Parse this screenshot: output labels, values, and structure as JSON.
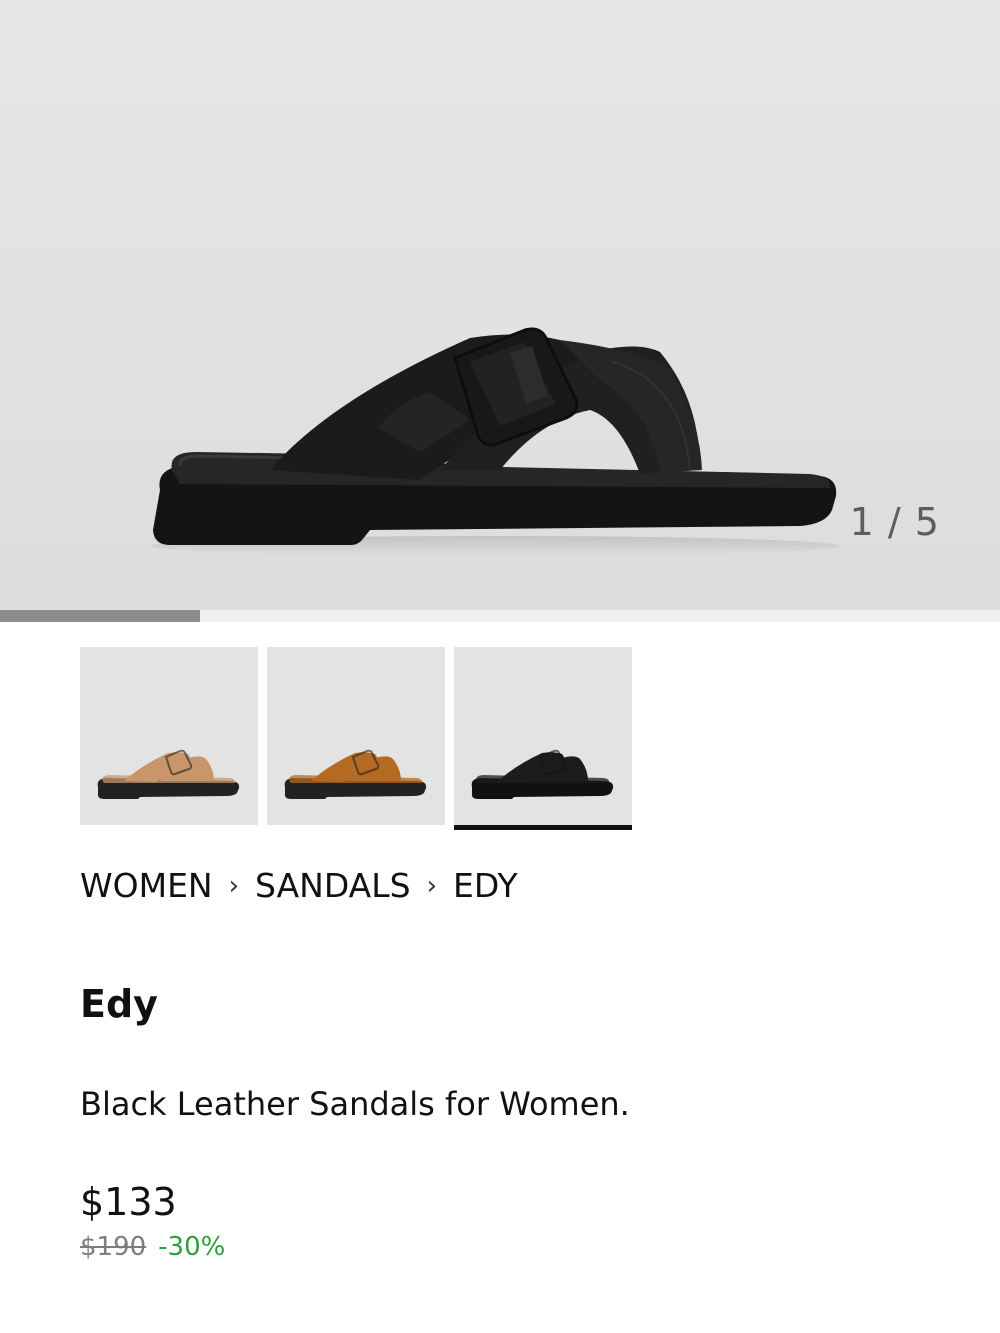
{
  "gallery": {
    "counter": "1 / 5",
    "progress": 0.2
  },
  "thumbnails": [
    {
      "name": "thumb-color-beige",
      "color": "#c8966a",
      "sole": "#222222"
    },
    {
      "name": "thumb-color-brown",
      "color": "#b56a22",
      "sole": "#222222"
    },
    {
      "name": "thumb-color-black",
      "color": "#1c1c1c",
      "sole": "#111111"
    }
  ],
  "breadcrumb": {
    "items": [
      "WOMEN",
      "SANDALS",
      "EDY"
    ],
    "separator": "›"
  },
  "product": {
    "title": "Edy",
    "description": "Black Leather Sandals for Women.",
    "price": "$133",
    "old_price": "$190",
    "discount": "-30%"
  },
  "colors": {
    "discount": "#2f9e3b",
    "active_indicator": "#111111",
    "text": "#111111"
  }
}
